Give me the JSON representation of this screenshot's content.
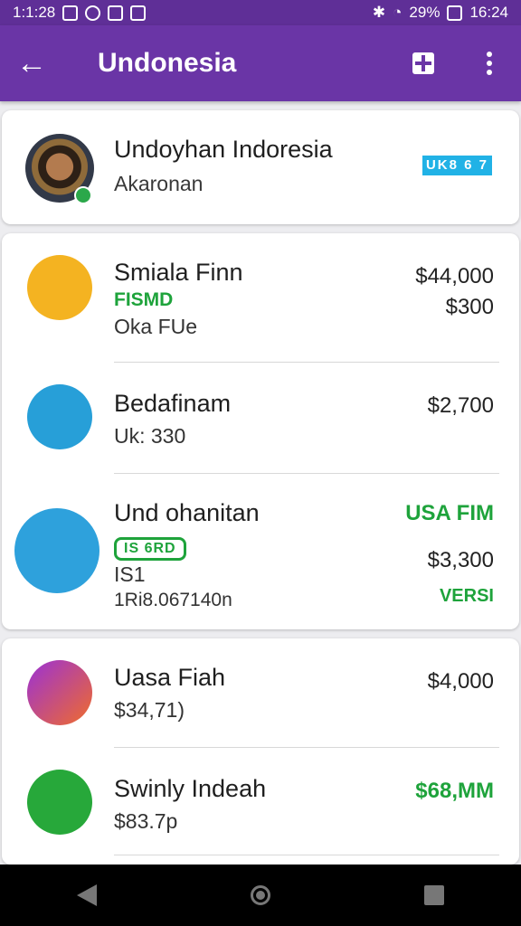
{
  "status": {
    "time_left": "1:1:28",
    "battery": "29%",
    "time_right": "16:24"
  },
  "appbar": {
    "title": "Undonesia"
  },
  "profile": {
    "name": "Undoyhan Indoresia",
    "subtitle": "Akaronan",
    "chip": "UK8 6 7"
  },
  "list1": [
    {
      "name": "Smiala Finn",
      "line1": "FISMD",
      "line2": "Oka FUe",
      "amount1": "$44,000",
      "amount2": "$300",
      "icon": "gear-icon",
      "color": "#f4b321"
    },
    {
      "name": "Bedafinam",
      "line1": "Uk: 330",
      "line2": "",
      "amount1": "$2,700",
      "amount2": "",
      "icon": "menu-icon",
      "color": "#279fd8"
    },
    {
      "name": "Und ohanitan",
      "line1": "IS 6RD",
      "line2": "IS1",
      "line3": "1Ri8.067140n",
      "amount1": "USA FIM",
      "amount2": "$3,300",
      "amount3": "VERSI",
      "icon": "bowtie-icon",
      "color": "#2ea1dc"
    }
  ],
  "list2": [
    {
      "name": "Uasa Fiah",
      "line1": "$34,71)",
      "amount1": "$4,000",
      "icon": "camera-icon",
      "color": "#d53b8c"
    },
    {
      "name": "Swinly Indeah",
      "line1": "$83.7p",
      "amount1": "$68,MM",
      "icon": "phone-icon",
      "color": "#27a83a"
    }
  ]
}
